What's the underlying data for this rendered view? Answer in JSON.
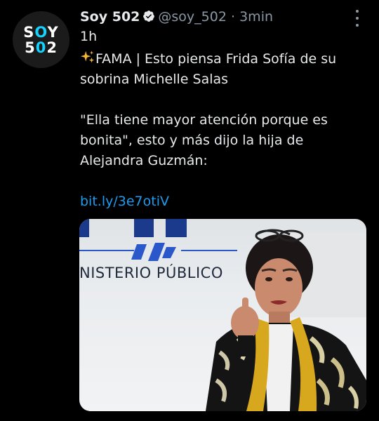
{
  "avatar": {
    "line1": "SOY",
    "line2": "502"
  },
  "header": {
    "name": "Soy 502",
    "handle": "@soy_502",
    "separator": "·",
    "time": "3min",
    "time_line2": "1h"
  },
  "tweet": {
    "line1": "FAMA | Esto piensa Frida Sofía de su",
    "line2": "sobrina Michelle Salas",
    "quote1": "\"Ella tiene mayor atención porque es",
    "quote2": "bonita\", esto y más dijo la hija de",
    "quote3": "Alejandra Guzmán:",
    "link": "bit.ly/3e7otiV"
  },
  "media": {
    "sign_text": "NISTERIO PÚBLICO"
  },
  "icons": {
    "verified": "verified-badge-icon",
    "more": "more-options-icon",
    "sparkle": "sparkles-emoji-icon"
  },
  "colors": {
    "accent": "#1d9bf0",
    "background": "#000000",
    "text": "#e7e9ea",
    "muted": "#8b98a5"
  }
}
